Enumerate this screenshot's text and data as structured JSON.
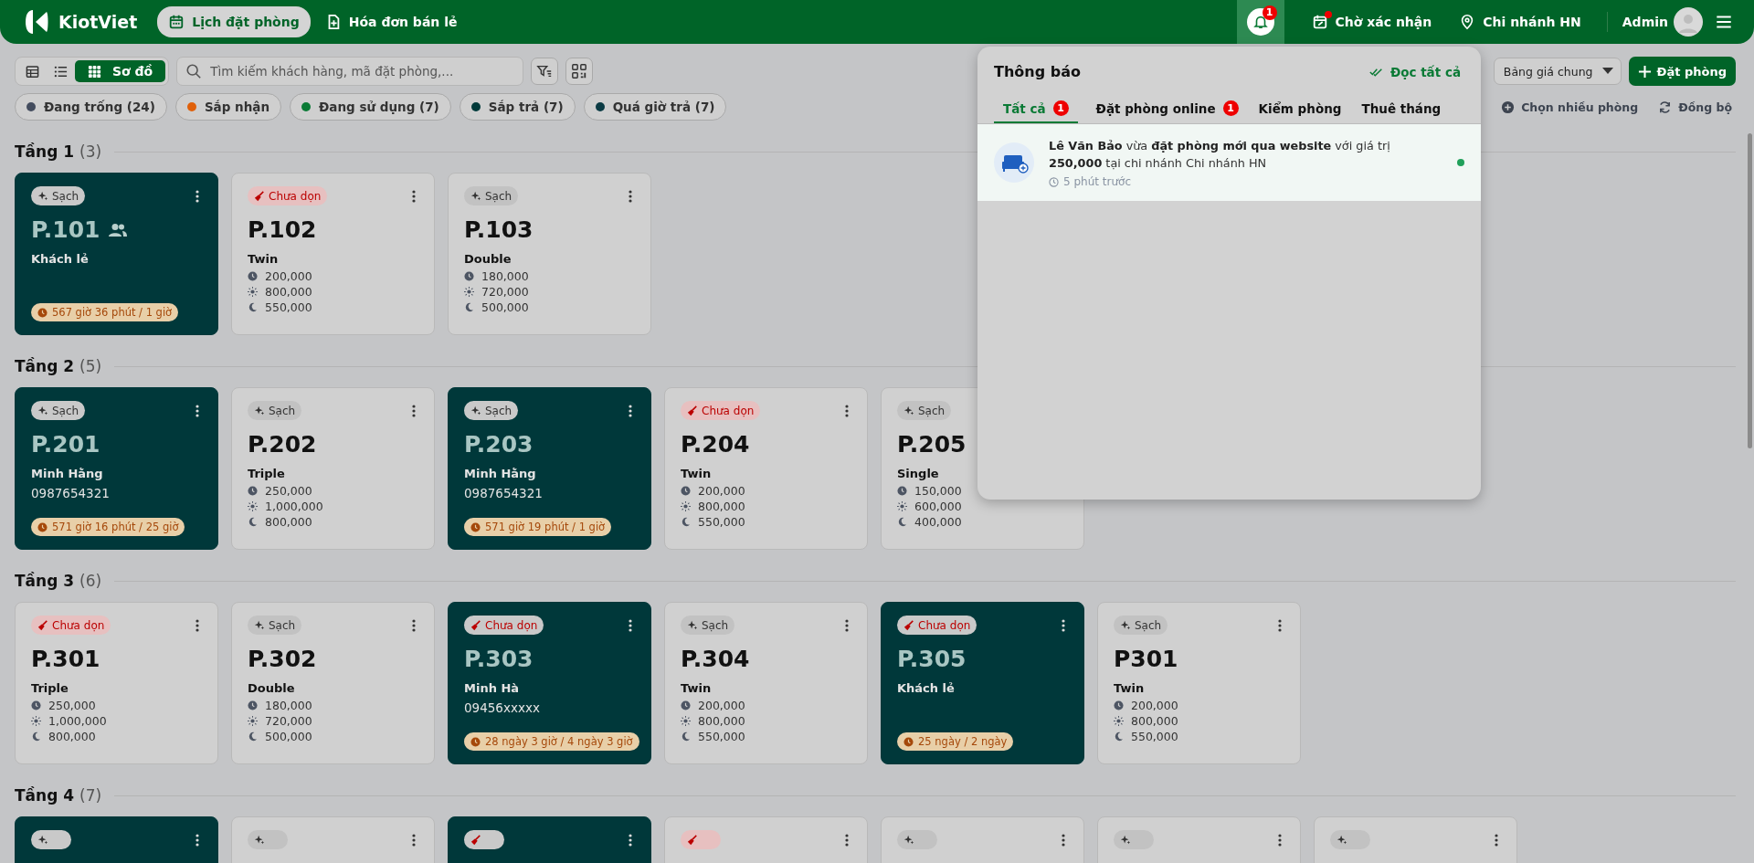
{
  "topbar": {
    "logo": "KiotViet",
    "nav": [
      {
        "label": "Lịch đặt phòng",
        "selected": true
      },
      {
        "label": "Hóa đơn bán lẻ",
        "selected": false
      }
    ],
    "bell_badge": "1",
    "pending": {
      "label": "Chờ xác nhận",
      "alert": true
    },
    "branch": "Chi nhánh HN",
    "user": "Admin"
  },
  "toolbar": {
    "views": [
      {
        "kind": "table",
        "selected": false
      },
      {
        "kind": "list",
        "selected": false
      },
      {
        "kind": "grid",
        "label": "Sơ đồ",
        "selected": true
      }
    ],
    "search": {
      "placeholder": "Tìm kiếm khách hàng, mã đặt phòng,..."
    },
    "price_list": "Bảng giá chung",
    "book_button": "Đặt phòng",
    "multi_select": "Chọn nhiều phòng",
    "sync": "Đồng bộ"
  },
  "status_filters": [
    {
      "label": "Đang trống (24)",
      "color": "#434c5e"
    },
    {
      "label": "Sắp nhận",
      "color": "#e0600a"
    },
    {
      "label": "Đang sử dụng (7)",
      "color": "#0a7a35"
    },
    {
      "label": "Sắp trả (7)",
      "color": "#003a3a"
    },
    {
      "label": "Quá giờ trả (7)",
      "color": "#0b3b44"
    }
  ],
  "floors": [
    {
      "name": "Tầng 1",
      "count": "(3)",
      "rooms": [
        {
          "number": "P.101",
          "occupied": true,
          "group": true,
          "cleaning": {
            "kind": "clean",
            "label": "Sạch"
          },
          "guest": "Khách lẻ",
          "duration": "567 giờ 36 phút / 1 giờ"
        },
        {
          "number": "P.102",
          "occupied": false,
          "cleaning": {
            "kind": "dirty",
            "label": "Chưa dọn"
          },
          "room_type": "Twin",
          "prices": [
            {
              "kind": "hour",
              "value": "200,000"
            },
            {
              "kind": "day",
              "value": "800,000"
            },
            {
              "kind": "night",
              "value": "550,000"
            }
          ]
        },
        {
          "number": "P.103",
          "occupied": false,
          "cleaning": {
            "kind": "clean",
            "label": "Sạch"
          },
          "room_type": "Double",
          "prices": [
            {
              "kind": "hour",
              "value": "180,000"
            },
            {
              "kind": "day",
              "value": "720,000"
            },
            {
              "kind": "night",
              "value": "500,000"
            }
          ]
        }
      ]
    },
    {
      "name": "Tầng 2",
      "count": "(5)",
      "rooms": [
        {
          "number": "P.201",
          "occupied": true,
          "cleaning": {
            "kind": "clean",
            "label": "Sạch"
          },
          "guest": "Minh Hằng",
          "phone": "0987654321",
          "duration": "571 giờ 16 phút / 25 giờ"
        },
        {
          "number": "P.202",
          "occupied": false,
          "cleaning": {
            "kind": "clean",
            "label": "Sạch"
          },
          "room_type": "Triple",
          "prices": [
            {
              "kind": "hour",
              "value": "250,000"
            },
            {
              "kind": "day",
              "value": "1,000,000"
            },
            {
              "kind": "night",
              "value": "800,000"
            }
          ]
        },
        {
          "number": "P.203",
          "occupied": true,
          "cleaning": {
            "kind": "clean",
            "label": "Sạch"
          },
          "guest": "Minh Hằng",
          "phone": "0987654321",
          "duration": "571 giờ 19 phút / 1 giờ"
        },
        {
          "number": "P.204",
          "occupied": false,
          "cleaning": {
            "kind": "dirty",
            "label": "Chưa dọn"
          },
          "room_type": "Twin",
          "prices": [
            {
              "kind": "hour",
              "value": "200,000"
            },
            {
              "kind": "day",
              "value": "800,000"
            },
            {
              "kind": "night",
              "value": "550,000"
            }
          ]
        },
        {
          "number": "P.205",
          "occupied": false,
          "cleaning": {
            "kind": "clean",
            "label": "Sạch"
          },
          "room_type": "Single",
          "prices": [
            {
              "kind": "hour",
              "value": "150,000"
            },
            {
              "kind": "day",
              "value": "600,000"
            },
            {
              "kind": "night",
              "value": "400,000"
            }
          ]
        }
      ]
    },
    {
      "name": "Tầng 3",
      "count": "(6)",
      "rooms": [
        {
          "number": "P.301",
          "occupied": false,
          "cleaning": {
            "kind": "dirty",
            "label": "Chưa dọn"
          },
          "room_type": "Triple",
          "prices": [
            {
              "kind": "hour",
              "value": "250,000"
            },
            {
              "kind": "day",
              "value": "1,000,000"
            },
            {
              "kind": "night",
              "value": "800,000"
            }
          ]
        },
        {
          "number": "P.302",
          "occupied": false,
          "cleaning": {
            "kind": "clean",
            "label": "Sạch"
          },
          "room_type": "Double",
          "prices": [
            {
              "kind": "hour",
              "value": "180,000"
            },
            {
              "kind": "day",
              "value": "720,000"
            },
            {
              "kind": "night",
              "value": "500,000"
            }
          ]
        },
        {
          "number": "P.303",
          "occupied": true,
          "cleaning": {
            "kind": "dirty",
            "label": "Chưa dọn"
          },
          "guest": "Minh Hà",
          "phone": "09456xxxxx",
          "duration": "28 ngày 3 giờ / 4 ngày 3 giờ"
        },
        {
          "number": "P.304",
          "occupied": false,
          "cleaning": {
            "kind": "clean",
            "label": "Sạch"
          },
          "room_type": "Twin",
          "prices": [
            {
              "kind": "hour",
              "value": "200,000"
            },
            {
              "kind": "day",
              "value": "800,000"
            },
            {
              "kind": "night",
              "value": "550,000"
            }
          ]
        },
        {
          "number": "P.305",
          "occupied": true,
          "cleaning": {
            "kind": "dirty",
            "label": "Chưa dọn"
          },
          "guest": "Khách lẻ",
          "duration": "25 ngày / 2 ngày"
        },
        {
          "number": "P301",
          "occupied": false,
          "cleaning": {
            "kind": "clean",
            "label": "Sạch"
          },
          "room_type": "Twin",
          "prices": [
            {
              "kind": "hour",
              "value": "200,000"
            },
            {
              "kind": "day",
              "value": "800,000"
            },
            {
              "kind": "night",
              "value": "550,000"
            }
          ]
        }
      ]
    },
    {
      "name": "Tầng 4",
      "count": "(7)",
      "rooms": [
        {
          "occupied": true,
          "cleaning": {
            "kind": "clean"
          }
        },
        {
          "occupied": false,
          "cleaning": {
            "kind": "clean"
          }
        },
        {
          "occupied": true,
          "cleaning": {
            "kind": "dirty"
          }
        },
        {
          "occupied": false,
          "cleaning": {
            "kind": "dirty"
          }
        },
        {
          "occupied": false,
          "cleaning": {
            "kind": "clean"
          }
        },
        {
          "occupied": false,
          "cleaning": {
            "kind": "clean"
          }
        },
        {
          "occupied": false,
          "cleaning": {
            "kind": "clean"
          }
        }
      ]
    }
  ],
  "notifications": {
    "title": "Thông báo",
    "read_all": "Đọc tất cả",
    "tabs": [
      {
        "label": "Tất cả",
        "badge": "1",
        "selected": true
      },
      {
        "label": "Đặt phòng online",
        "badge": "1",
        "selected": false
      },
      {
        "label": "Kiểm phòng",
        "selected": false
      },
      {
        "label": "Thuê tháng",
        "selected": false
      }
    ],
    "items": [
      {
        "text": "**Lê Văn Bảo** vừa **đặt phòng mới qua website** với giá trị **250,000** tại chi nhánh Chi nhánh HN",
        "time": "5 phút trước",
        "unread": true
      }
    ]
  }
}
